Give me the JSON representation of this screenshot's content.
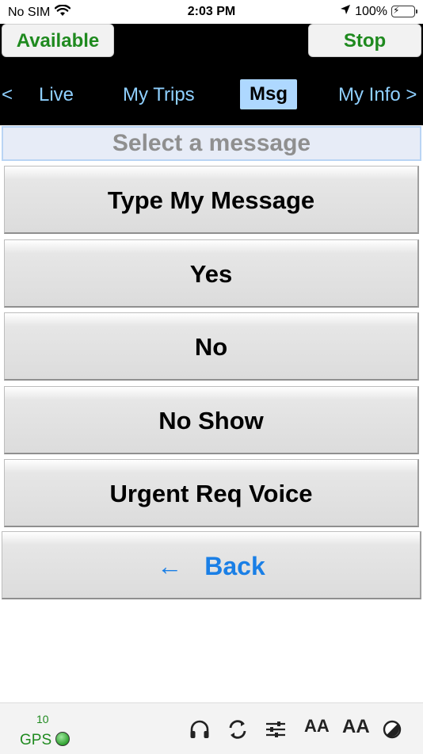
{
  "status_bar": {
    "carrier": "No SIM",
    "time": "2:03 PM",
    "battery": "100%"
  },
  "header": {
    "available_label": "Available",
    "stop_label": "Stop",
    "tabs": {
      "prev": "<",
      "live": "Live",
      "trips": "My Trips",
      "msg": "Msg",
      "info": "My Info >"
    }
  },
  "title": "Select a message",
  "messages": [
    "Type My Message",
    "Yes",
    "No",
    "No Show",
    "Urgent Req Voice"
  ],
  "back": {
    "arrow": "←",
    "label": "Back"
  },
  "footer": {
    "gps_count": "10",
    "gps_label": "GPS",
    "font_small": "AA",
    "font_large": "AA",
    "icons": [
      "headphones-icon",
      "sync-icon",
      "sliders-icon",
      "font-size-small-icon",
      "font-size-large-icon",
      "contrast-icon"
    ]
  },
  "colors": {
    "accent_green": "#1f8a1f",
    "tab_text": "#8fd0ff",
    "tab_active_bg": "#aed8ff",
    "link_blue": "#1a7fe6"
  }
}
